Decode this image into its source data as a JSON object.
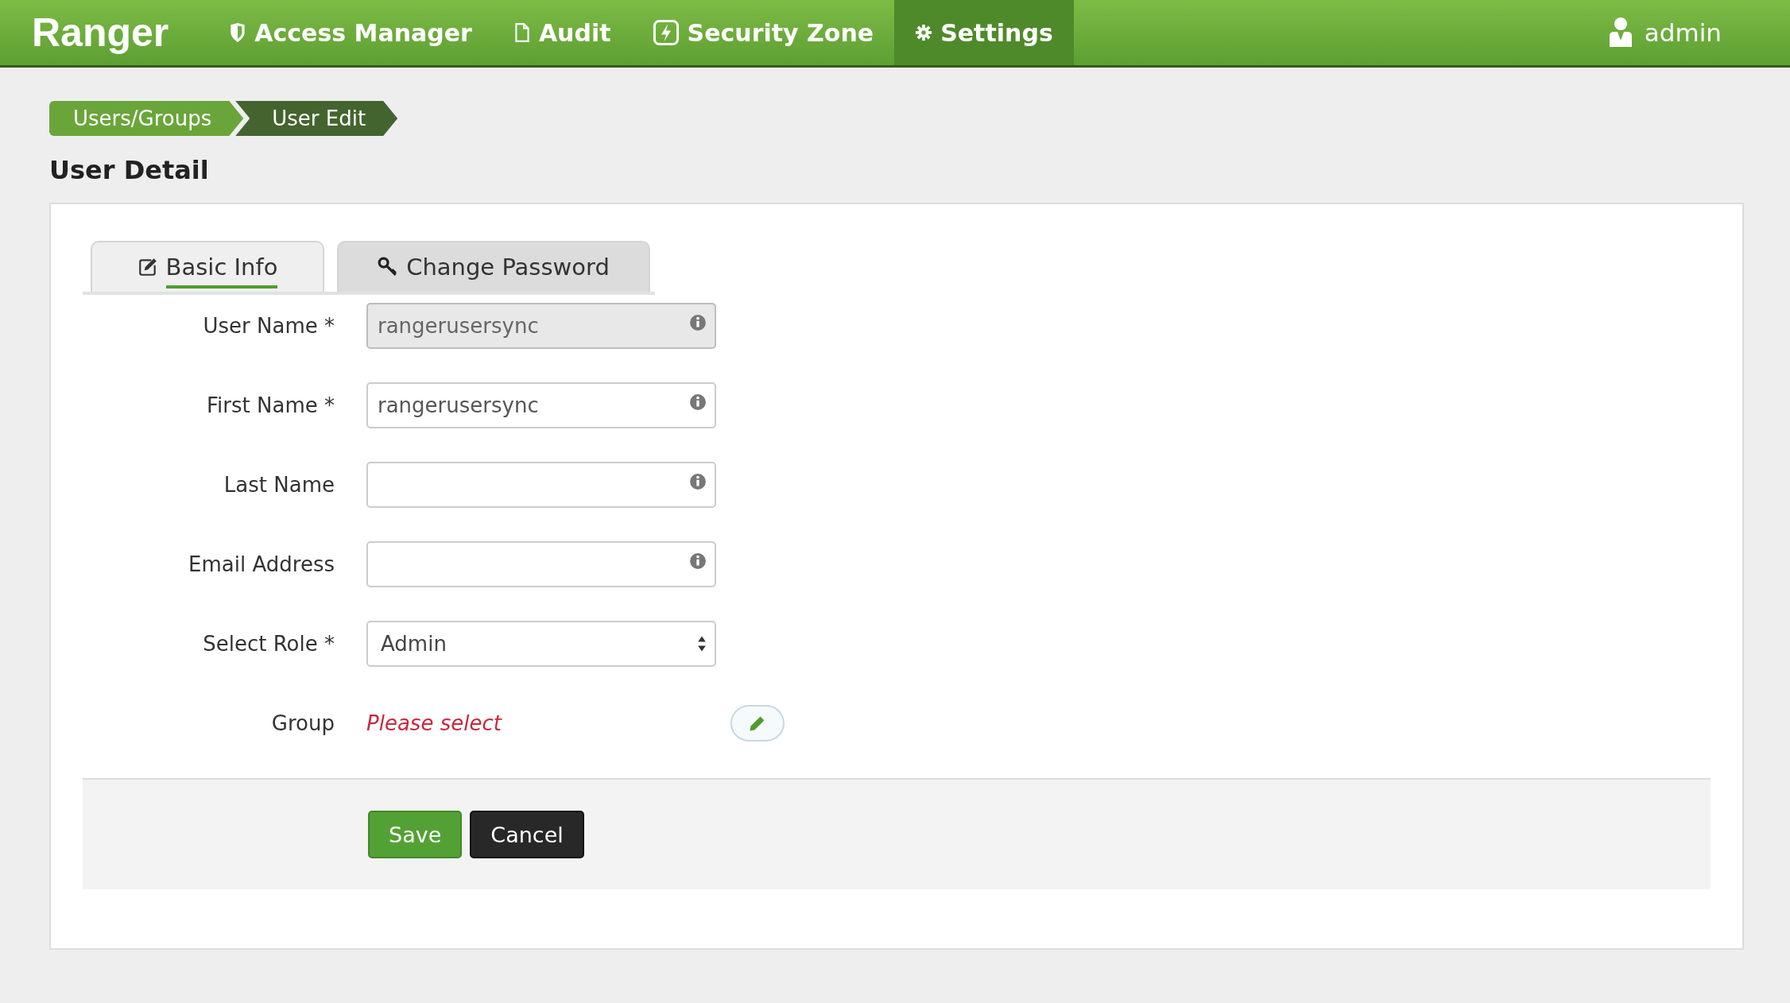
{
  "header": {
    "brand": "Ranger",
    "nav": [
      {
        "label": "Access Manager",
        "kind": "shield",
        "selected": false
      },
      {
        "label": "Audit",
        "kind": "file",
        "selected": false
      },
      {
        "label": "Security Zone",
        "kind": "bolt",
        "selected": false
      },
      {
        "label": "Settings",
        "kind": "gear",
        "selected": true
      }
    ],
    "user": "admin"
  },
  "breadcrumb": [
    {
      "label": "Users/Groups",
      "kind": "link"
    },
    {
      "label": "User Edit",
      "kind": "current"
    }
  ],
  "title": "User Detail",
  "tabs": [
    {
      "label": "Basic Info",
      "kind": "edit",
      "selected": true
    },
    {
      "label": "Change Password",
      "kind": "key",
      "selected": false
    }
  ],
  "fields": [
    {
      "label": "User Name *",
      "kind": "text",
      "value": "rangerusersync",
      "disabled": true
    },
    {
      "label": "First Name *",
      "kind": "text",
      "value": "rangerusersync",
      "disabled": false
    },
    {
      "label": "Last Name",
      "kind": "text",
      "disabled": false
    },
    {
      "label": "Email Address",
      "kind": "text",
      "disabled": false
    },
    {
      "label": "Select Role *",
      "kind": "select",
      "value": "Admin"
    },
    {
      "label": "Group",
      "kind": "picker",
      "value": "Please select"
    }
  ],
  "buttons": [
    {
      "label": "Save",
      "kind": "primary"
    },
    {
      "label": "Cancel",
      "kind": "dark"
    }
  ]
}
